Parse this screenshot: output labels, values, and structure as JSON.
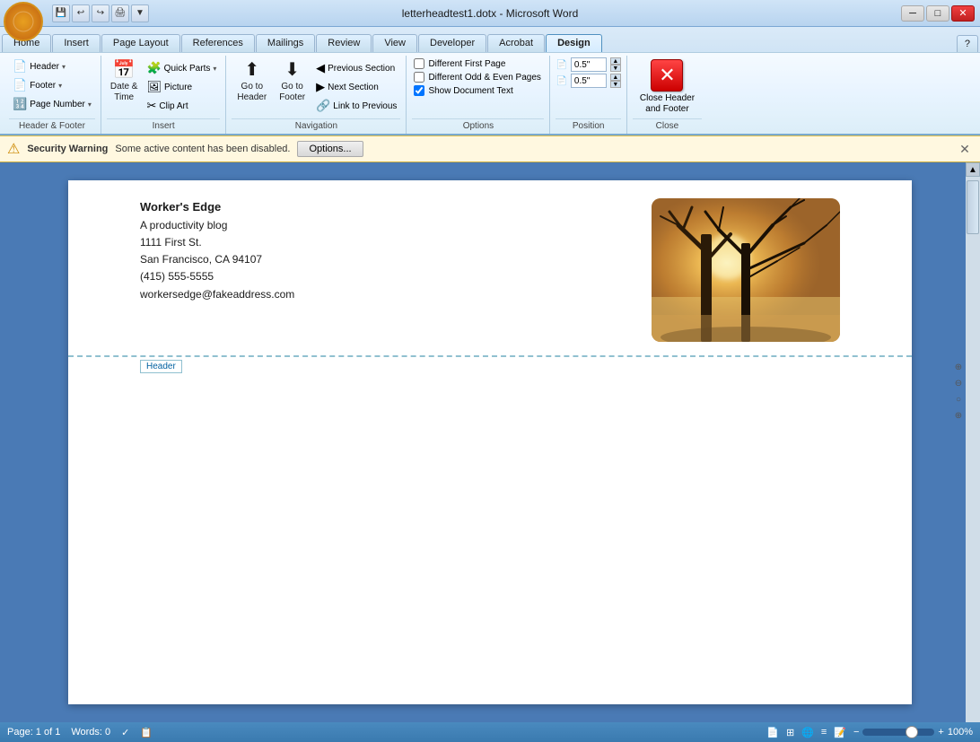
{
  "titleBar": {
    "title": "letterheadtest1.dotx - Microsoft Word",
    "windowControls": {
      "minimize": "─",
      "maximize": "□",
      "close": "✕"
    }
  },
  "ribbon": {
    "tabs": [
      {
        "id": "home",
        "label": "Home",
        "key": "H"
      },
      {
        "id": "insert",
        "label": "Insert",
        "key": "N"
      },
      {
        "id": "page_layout",
        "label": "Page Layout",
        "key": "P"
      },
      {
        "id": "references",
        "label": "References",
        "key": "S"
      },
      {
        "id": "mailings",
        "label": "Mailings",
        "key": "M"
      },
      {
        "id": "review",
        "label": "Review",
        "key": "R"
      },
      {
        "id": "view",
        "label": "View",
        "key": "W"
      },
      {
        "id": "developer",
        "label": "Developer",
        "key": "L"
      },
      {
        "id": "acrobat",
        "label": "Acrobat",
        "key": "B"
      },
      {
        "id": "design",
        "label": "Design",
        "key": "JH",
        "active": true
      }
    ],
    "groups": {
      "headerFooter": {
        "label": "Header & Footer",
        "items": [
          {
            "id": "header",
            "label": "Header",
            "dropdown": true
          },
          {
            "id": "footer",
            "label": "Footer",
            "dropdown": true
          },
          {
            "id": "page_number",
            "label": "Page Number",
            "dropdown": true
          }
        ]
      },
      "insert": {
        "label": "Insert",
        "items": [
          {
            "id": "date_time",
            "label": "Date & Time"
          },
          {
            "id": "quick_parts",
            "label": "Quick Parts",
            "dropdown": true
          },
          {
            "id": "picture",
            "label": "Picture"
          },
          {
            "id": "clip_art",
            "label": "Clip Art"
          }
        ]
      },
      "navigation": {
        "label": "Navigation",
        "items": [
          {
            "id": "go_to_header",
            "label": "Go to Header"
          },
          {
            "id": "go_to_footer",
            "label": "Go to Footer"
          },
          {
            "id": "previous_section",
            "label": "Previous Section"
          },
          {
            "id": "next_section",
            "label": "Next Section"
          },
          {
            "id": "link_to_previous",
            "label": "Link to Previous"
          }
        ]
      },
      "options": {
        "label": "Options",
        "items": [
          {
            "id": "different_first_page",
            "label": "Different First Page",
            "checked": false
          },
          {
            "id": "different_odd_even",
            "label": "Different Odd & Even Pages",
            "checked": false
          },
          {
            "id": "show_document_text",
            "label": "Show Document Text",
            "checked": true
          }
        ]
      },
      "position": {
        "label": "Position",
        "header_value": "0.5\"",
        "footer_value": "0.5\""
      },
      "close": {
        "label": "Close",
        "close_label": "Close Header\nand Footer"
      }
    }
  },
  "securityBar": {
    "title": "Security Warning",
    "message": "Some active content has been disabled.",
    "button": "Options...",
    "icon": "⚠"
  },
  "document": {
    "header": {
      "companyName": "Worker's Edge",
      "tagline": "A productivity blog",
      "address": "1111 First St.",
      "city": "San Francisco, CA 94107",
      "phone": "(415) 555-5555",
      "email": "workersedge@fakeaddress.com",
      "headerLabel": "Header"
    }
  },
  "statusBar": {
    "page": "Page: 1 of 1",
    "words": "Words: 0",
    "zoom": "100%",
    "zoomMinus": "−",
    "zoomPlus": "+"
  }
}
